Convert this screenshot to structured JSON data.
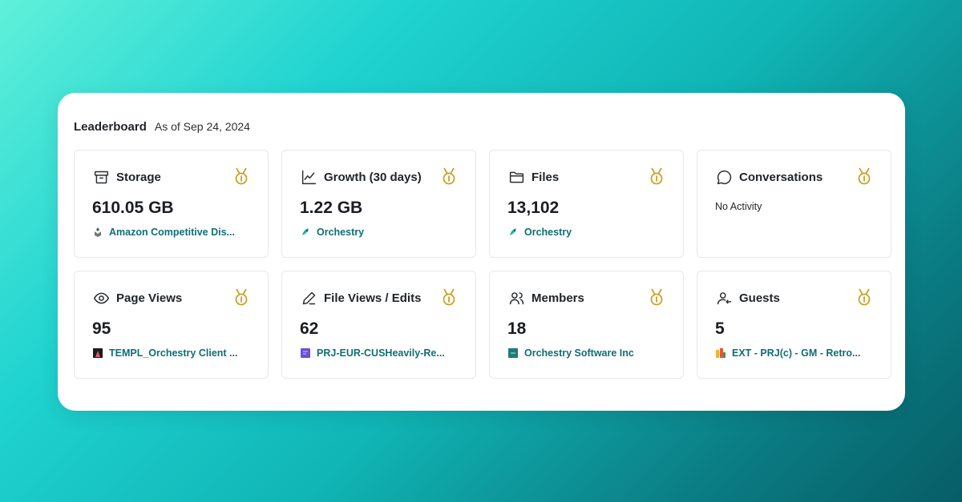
{
  "header": {
    "title": "Leaderboard",
    "as_of": "As of Sep 24, 2024"
  },
  "cards": [
    {
      "label": "Storage",
      "icon": "archive-icon",
      "value": "610.05 GB",
      "leader": "Amazon Competitive Dis...",
      "leader_icon": "team-logo-icon"
    },
    {
      "label": "Growth (30 days)",
      "icon": "line-chart-icon",
      "value": "1.22 GB",
      "leader": "Orchestry",
      "leader_icon": "orchestry-logo-icon"
    },
    {
      "label": "Files",
      "icon": "folder-icon",
      "value": "13,102",
      "leader": "Orchestry",
      "leader_icon": "orchestry-logo-icon"
    },
    {
      "label": "Conversations",
      "icon": "chat-bubble-icon",
      "value": "",
      "no_activity": "No Activity"
    },
    {
      "label": "Page Views",
      "icon": "eye-icon",
      "value": "95",
      "leader": "TEMPL_Orchestry Client ...",
      "leader_icon": "templ-logo-icon"
    },
    {
      "label": "File Views / Edits",
      "icon": "pencil-icon",
      "value": "62",
      "leader": "PRJ-EUR-CUSHeavily-Re...",
      "leader_icon": "prj-logo-icon"
    },
    {
      "label": "Members",
      "icon": "users-icon",
      "value": "18",
      "leader": "Orchestry Software Inc",
      "leader_icon": "os-logo-icon"
    },
    {
      "label": "Guests",
      "icon": "guest-user-icon",
      "value": "5",
      "leader": "EXT - PRJ(c) - GM - Retro...",
      "leader_icon": "ext-logo-icon"
    }
  ],
  "colors": {
    "medal": "#c9a227",
    "leader_text": "#0f6e74",
    "accent_bg": "#12c6c6"
  }
}
